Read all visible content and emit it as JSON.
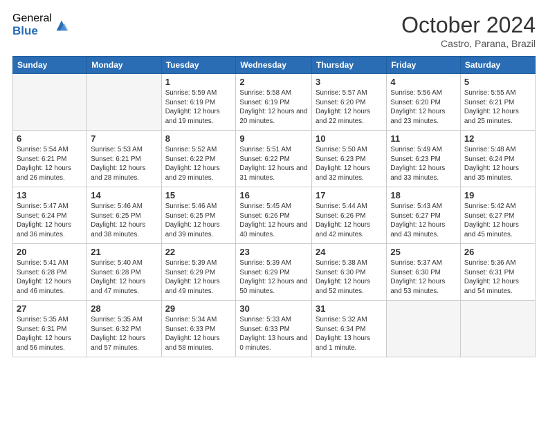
{
  "logo": {
    "general": "General",
    "blue": "Blue"
  },
  "title": "October 2024",
  "location": "Castro, Parana, Brazil",
  "days_of_week": [
    "Sunday",
    "Monday",
    "Tuesday",
    "Wednesday",
    "Thursday",
    "Friday",
    "Saturday"
  ],
  "weeks": [
    [
      {
        "day": "",
        "info": ""
      },
      {
        "day": "",
        "info": ""
      },
      {
        "day": "1",
        "info": "Sunrise: 5:59 AM\nSunset: 6:19 PM\nDaylight: 12 hours and 19 minutes."
      },
      {
        "day": "2",
        "info": "Sunrise: 5:58 AM\nSunset: 6:19 PM\nDaylight: 12 hours and 20 minutes."
      },
      {
        "day": "3",
        "info": "Sunrise: 5:57 AM\nSunset: 6:20 PM\nDaylight: 12 hours and 22 minutes."
      },
      {
        "day": "4",
        "info": "Sunrise: 5:56 AM\nSunset: 6:20 PM\nDaylight: 12 hours and 23 minutes."
      },
      {
        "day": "5",
        "info": "Sunrise: 5:55 AM\nSunset: 6:21 PM\nDaylight: 12 hours and 25 minutes."
      }
    ],
    [
      {
        "day": "6",
        "info": "Sunrise: 5:54 AM\nSunset: 6:21 PM\nDaylight: 12 hours and 26 minutes."
      },
      {
        "day": "7",
        "info": "Sunrise: 5:53 AM\nSunset: 6:21 PM\nDaylight: 12 hours and 28 minutes."
      },
      {
        "day": "8",
        "info": "Sunrise: 5:52 AM\nSunset: 6:22 PM\nDaylight: 12 hours and 29 minutes."
      },
      {
        "day": "9",
        "info": "Sunrise: 5:51 AM\nSunset: 6:22 PM\nDaylight: 12 hours and 31 minutes."
      },
      {
        "day": "10",
        "info": "Sunrise: 5:50 AM\nSunset: 6:23 PM\nDaylight: 12 hours and 32 minutes."
      },
      {
        "day": "11",
        "info": "Sunrise: 5:49 AM\nSunset: 6:23 PM\nDaylight: 12 hours and 33 minutes."
      },
      {
        "day": "12",
        "info": "Sunrise: 5:48 AM\nSunset: 6:24 PM\nDaylight: 12 hours and 35 minutes."
      }
    ],
    [
      {
        "day": "13",
        "info": "Sunrise: 5:47 AM\nSunset: 6:24 PM\nDaylight: 12 hours and 36 minutes."
      },
      {
        "day": "14",
        "info": "Sunrise: 5:46 AM\nSunset: 6:25 PM\nDaylight: 12 hours and 38 minutes."
      },
      {
        "day": "15",
        "info": "Sunrise: 5:46 AM\nSunset: 6:25 PM\nDaylight: 12 hours and 39 minutes."
      },
      {
        "day": "16",
        "info": "Sunrise: 5:45 AM\nSunset: 6:26 PM\nDaylight: 12 hours and 40 minutes."
      },
      {
        "day": "17",
        "info": "Sunrise: 5:44 AM\nSunset: 6:26 PM\nDaylight: 12 hours and 42 minutes."
      },
      {
        "day": "18",
        "info": "Sunrise: 5:43 AM\nSunset: 6:27 PM\nDaylight: 12 hours and 43 minutes."
      },
      {
        "day": "19",
        "info": "Sunrise: 5:42 AM\nSunset: 6:27 PM\nDaylight: 12 hours and 45 minutes."
      }
    ],
    [
      {
        "day": "20",
        "info": "Sunrise: 5:41 AM\nSunset: 6:28 PM\nDaylight: 12 hours and 46 minutes."
      },
      {
        "day": "21",
        "info": "Sunrise: 5:40 AM\nSunset: 6:28 PM\nDaylight: 12 hours and 47 minutes."
      },
      {
        "day": "22",
        "info": "Sunrise: 5:39 AM\nSunset: 6:29 PM\nDaylight: 12 hours and 49 minutes."
      },
      {
        "day": "23",
        "info": "Sunrise: 5:39 AM\nSunset: 6:29 PM\nDaylight: 12 hours and 50 minutes."
      },
      {
        "day": "24",
        "info": "Sunrise: 5:38 AM\nSunset: 6:30 PM\nDaylight: 12 hours and 52 minutes."
      },
      {
        "day": "25",
        "info": "Sunrise: 5:37 AM\nSunset: 6:30 PM\nDaylight: 12 hours and 53 minutes."
      },
      {
        "day": "26",
        "info": "Sunrise: 5:36 AM\nSunset: 6:31 PM\nDaylight: 12 hours and 54 minutes."
      }
    ],
    [
      {
        "day": "27",
        "info": "Sunrise: 5:35 AM\nSunset: 6:31 PM\nDaylight: 12 hours and 56 minutes."
      },
      {
        "day": "28",
        "info": "Sunrise: 5:35 AM\nSunset: 6:32 PM\nDaylight: 12 hours and 57 minutes."
      },
      {
        "day": "29",
        "info": "Sunrise: 5:34 AM\nSunset: 6:33 PM\nDaylight: 12 hours and 58 minutes."
      },
      {
        "day": "30",
        "info": "Sunrise: 5:33 AM\nSunset: 6:33 PM\nDaylight: 13 hours and 0 minutes."
      },
      {
        "day": "31",
        "info": "Sunrise: 5:32 AM\nSunset: 6:34 PM\nDaylight: 13 hours and 1 minute."
      },
      {
        "day": "",
        "info": ""
      },
      {
        "day": "",
        "info": ""
      }
    ]
  ]
}
